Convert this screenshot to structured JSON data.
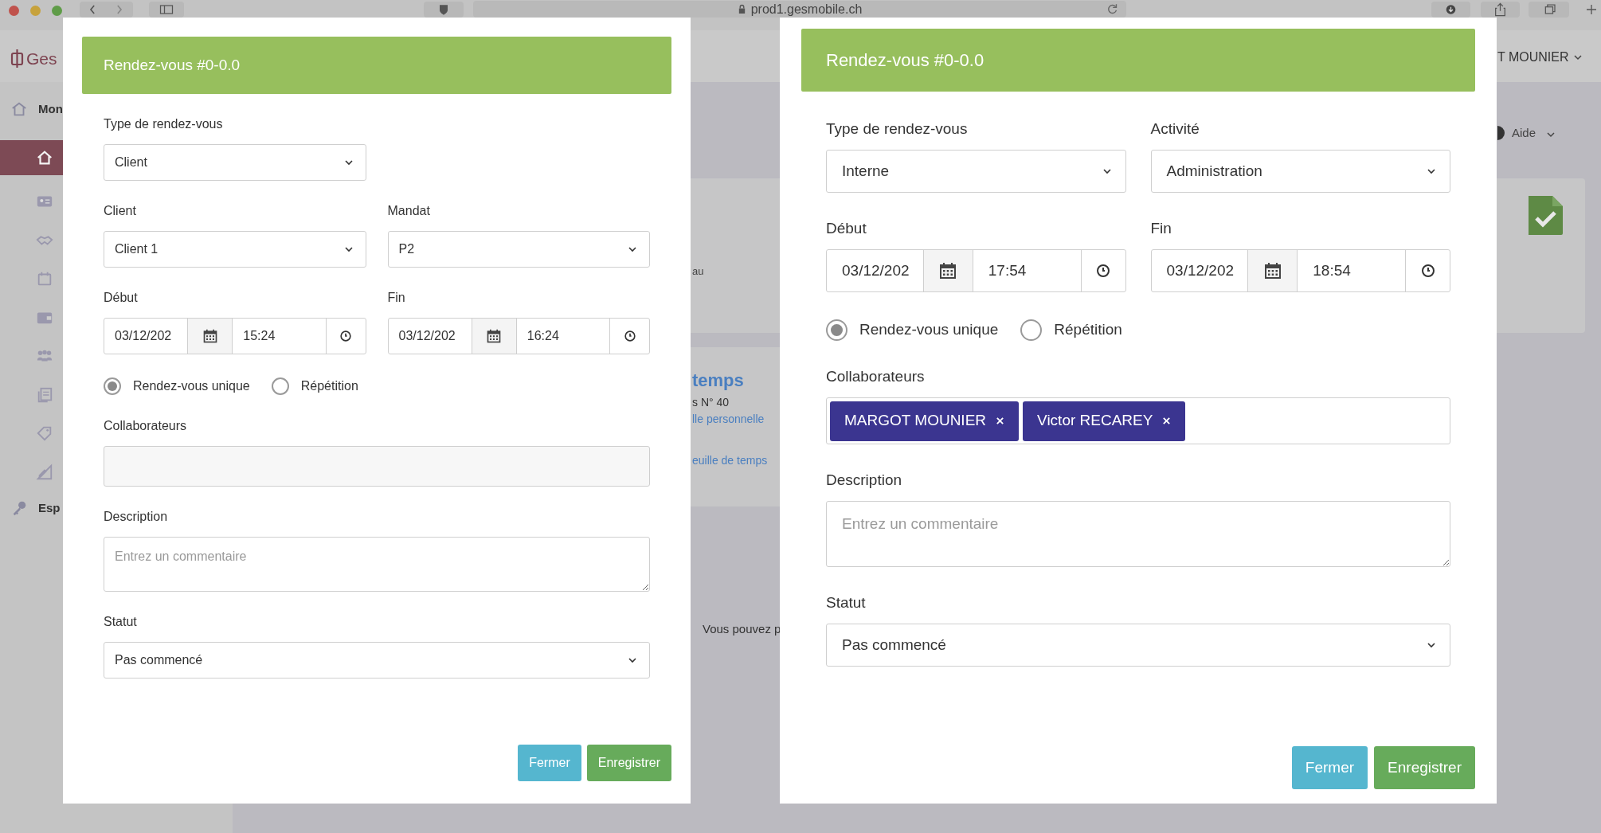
{
  "browser": {
    "url": "prod1.gesmobile.ch"
  },
  "app": {
    "logo": "Ges",
    "user": "T MOUNIER",
    "help": "Aide",
    "sections": [
      {
        "label": "Mon"
      },
      {
        "label": "Esp"
      }
    ],
    "sidebar": [
      {
        "selected": true
      },
      {
        "selected": false
      },
      {
        "selected": false
      },
      {
        "selected": false
      },
      {
        "selected": false
      },
      {
        "selected": false
      },
      {
        "selected": false
      },
      {
        "selected": false
      },
      {
        "selected": false
      }
    ],
    "card": {
      "note": "au",
      "title": "temps",
      "subtitle": "s N° 40",
      "links": [
        "lle personnelle",
        "euille de temps"
      ]
    },
    "footer_note": "Vous pouvez p"
  },
  "modals": [
    {
      "title": "Rendez-vous #0-0.0",
      "rows": [
        [
          {
            "kind": "select",
            "label": "Type de rendez-vous",
            "value": "Client"
          }
        ],
        [
          {
            "kind": "select",
            "label": "Client",
            "value": "Client 1"
          },
          {
            "kind": "select",
            "label": "Mandat",
            "value": "P2"
          }
        ],
        [
          {
            "kind": "datetime",
            "label": "Début",
            "date": "03/12/202",
            "time": "15:24"
          },
          {
            "kind": "datetime",
            "label": "Fin",
            "date": "03/12/202",
            "time": "16:24"
          }
        ],
        [
          {
            "kind": "radios",
            "options": [
              {
                "label": "Rendez-vous unique",
                "selected": true
              },
              {
                "label": "Répétition",
                "selected": false
              }
            ]
          }
        ],
        [
          {
            "kind": "tags",
            "label": "Collaborateurs"
          }
        ],
        [
          {
            "kind": "textarea",
            "label": "Description",
            "placeholder": "Entrez un commentaire"
          }
        ],
        [
          {
            "kind": "wide_select",
            "label": "Statut",
            "value": "Pas commencé"
          }
        ]
      ],
      "buttons": [
        {
          "label": "Fermer",
          "kind": "secondary"
        },
        {
          "label": "Enregistrer",
          "kind": "primary"
        }
      ]
    },
    {
      "title": "Rendez-vous #0-0.0",
      "rows": [
        [
          {
            "kind": "select",
            "label": "Type de rendez-vous",
            "value": "Interne"
          },
          {
            "kind": "select",
            "label": "Activité",
            "value": "Administration"
          }
        ],
        [
          {
            "kind": "datetime",
            "label": "Début",
            "date": "03/12/202",
            "time": "17:54"
          },
          {
            "kind": "datetime",
            "label": "Fin",
            "date": "03/12/202",
            "time": "18:54"
          }
        ],
        [
          {
            "kind": "radios",
            "options": [
              {
                "label": "Rendez-vous unique",
                "selected": true
              },
              {
                "label": "Répétition",
                "selected": false
              }
            ]
          }
        ],
        [
          {
            "kind": "tags",
            "label": "Collaborateurs",
            "tags": [
              "MARGOT MOUNIER",
              "Victor RECAREY"
            ]
          }
        ],
        [
          {
            "kind": "textarea",
            "label": "Description",
            "placeholder": "Entrez un commentaire"
          }
        ],
        [
          {
            "kind": "wide_select",
            "label": "Statut",
            "value": "Pas commencé"
          }
        ]
      ],
      "buttons": [
        {
          "label": "Fermer",
          "kind": "secondary"
        },
        {
          "label": "Enregistrer",
          "kind": "primary"
        }
      ]
    }
  ]
}
